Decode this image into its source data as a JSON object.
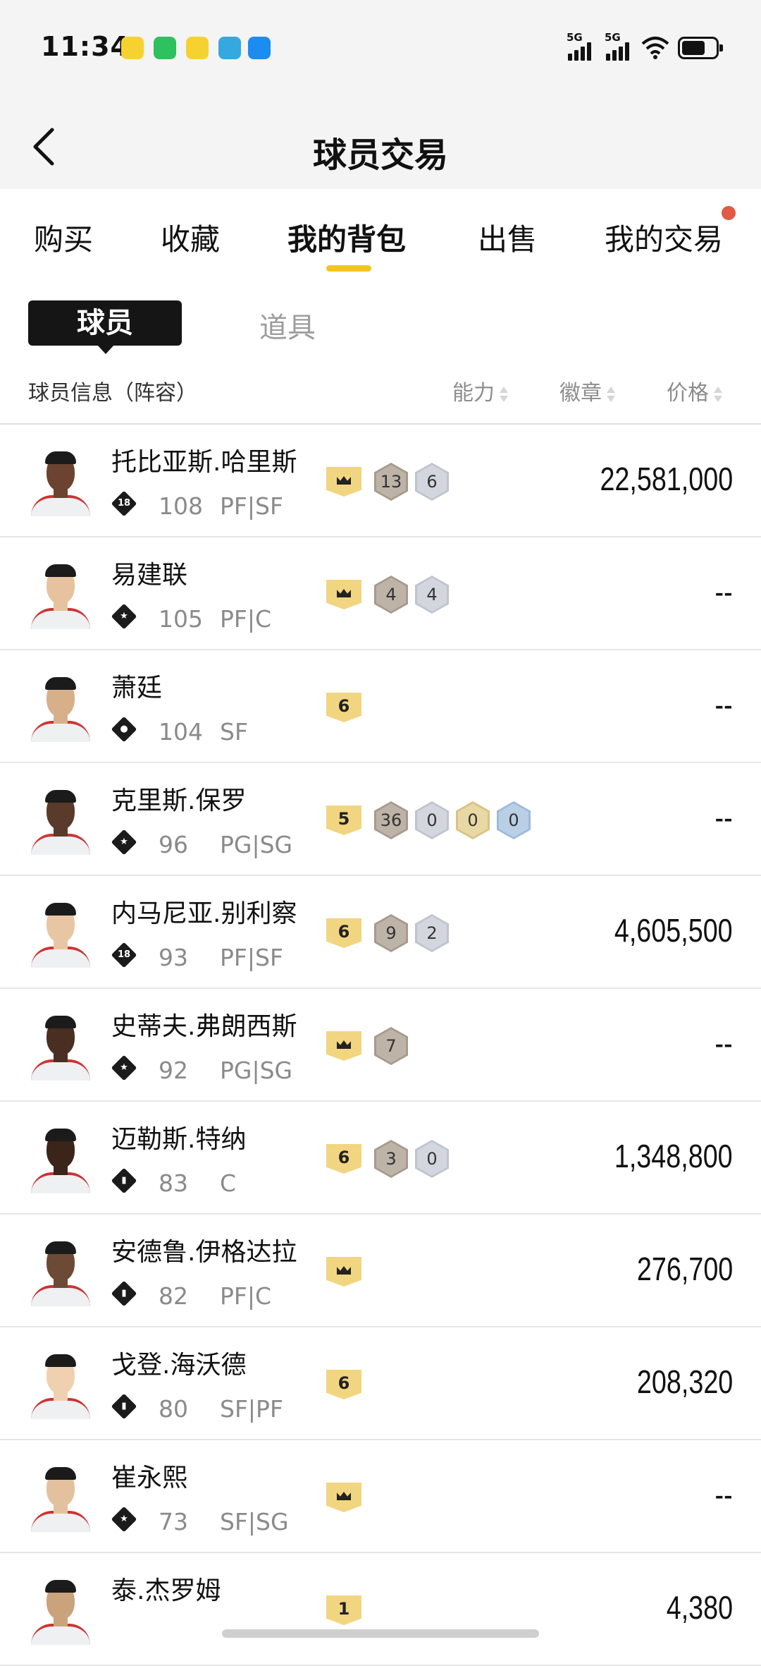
{
  "status_bar": {
    "time": "11:34",
    "signal1": "5G",
    "signal2": "5G"
  },
  "header": {
    "title": "球员交易"
  },
  "tabs": [
    {
      "label": "购买"
    },
    {
      "label": "收藏"
    },
    {
      "label": "我的背包"
    },
    {
      "label": "出售"
    },
    {
      "label": "我的交易"
    }
  ],
  "subtabs": {
    "players": "球员",
    "items": "道具"
  },
  "columns": {
    "info": "球员信息（阵容）",
    "ability": "能力",
    "badge": "徽章",
    "price": "价格"
  },
  "players": [
    {
      "name": "托比亚斯.哈里斯",
      "tier_icon": "18",
      "rating": "108",
      "position": "PF|SF",
      "level": "crown",
      "badges": [
        "13",
        "6"
      ],
      "price": "22,581,000"
    },
    {
      "name": "易建联",
      "tier_icon": "star",
      "rating": "105",
      "position": "PF|C",
      "level": "crown",
      "badges": [
        "4",
        "4"
      ],
      "price": "--"
    },
    {
      "name": "萧廷",
      "tier_icon": "person",
      "rating": "104",
      "position": "SF",
      "level": "6",
      "badges": [],
      "price": "--"
    },
    {
      "name": "克里斯.保罗",
      "tier_icon": "star",
      "rating": "96",
      "position": "PG|SG",
      "level": "5",
      "badges": [
        "36",
        "0",
        "0",
        "0"
      ],
      "price": "--"
    },
    {
      "name": "内马尼亚.别利察",
      "tier_icon": "18",
      "rating": "93",
      "position": "PF|SF",
      "level": "6",
      "badges": [
        "9",
        "2"
      ],
      "price": "4,605,500"
    },
    {
      "name": "史蒂夫.弗朗西斯",
      "tier_icon": "star",
      "rating": "92",
      "position": "PG|SG",
      "level": "crown",
      "badges": [
        "7"
      ],
      "price": "--"
    },
    {
      "name": "迈勒斯.特纳",
      "tier_icon": "bars",
      "rating": "83",
      "position": "C",
      "level": "6",
      "badges": [
        "3",
        "0"
      ],
      "price": "1,348,800"
    },
    {
      "name": "安德鲁.伊格达拉",
      "tier_icon": "bars",
      "rating": "82",
      "position": "PF|C",
      "level": "crown",
      "badges": [],
      "price": "276,700"
    },
    {
      "name": "戈登.海沃德",
      "tier_icon": "bars",
      "rating": "80",
      "position": "SF|PF",
      "level": "6",
      "badges": [],
      "price": "208,320"
    },
    {
      "name": "崔永熙",
      "tier_icon": "star",
      "rating": "73",
      "position": "SF|SG",
      "level": "crown",
      "badges": [],
      "price": "--"
    },
    {
      "name": "泰.杰罗姆",
      "tier_icon": "",
      "rating": "",
      "position": "",
      "level": "1",
      "badges": [],
      "price": "4,380"
    }
  ],
  "colors": {
    "accent": "#f3c51c",
    "notification": "#e05a45",
    "active_subtab": "#151515",
    "muted_text": "#8a8a8a"
  }
}
